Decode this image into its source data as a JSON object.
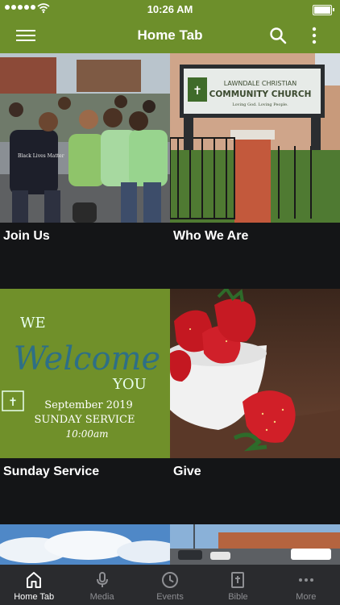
{
  "status_bar": {
    "time": "10:26 AM"
  },
  "app_bar": {
    "title": "Home Tab"
  },
  "tiles": [
    {
      "label": "Join Us"
    },
    {
      "label": "Who We Are"
    },
    {
      "label": "Sunday Service"
    },
    {
      "label": "Give"
    },
    {
      "label": ""
    },
    {
      "label": ""
    }
  ],
  "church_sign": {
    "line1": "LAWNDALE CHRISTIAN",
    "line2": "COMMUNITY CHURCH",
    "tagline": "Loving God. Loving People."
  },
  "welcome_flyer": {
    "we": "WE",
    "welcome": "Welcome",
    "you": "YOU",
    "date": "September 2019",
    "service": "SUNDAY SERVICE",
    "time": "10:00am"
  },
  "shirt_text": "Black Lives Matter",
  "tab_bar": [
    {
      "label": "Home Tab",
      "icon": "home-icon",
      "active": true
    },
    {
      "label": "Media",
      "icon": "microphone-icon",
      "active": false
    },
    {
      "label": "Events",
      "icon": "clock-icon",
      "active": false
    },
    {
      "label": "Bible",
      "icon": "bible-icon",
      "active": false
    },
    {
      "label": "More",
      "icon": "more-dots-icon",
      "active": false
    }
  ],
  "colors": {
    "brand_green": "#6d8f2b",
    "tab_bar": "#2a2b2e",
    "background": "#141517"
  }
}
